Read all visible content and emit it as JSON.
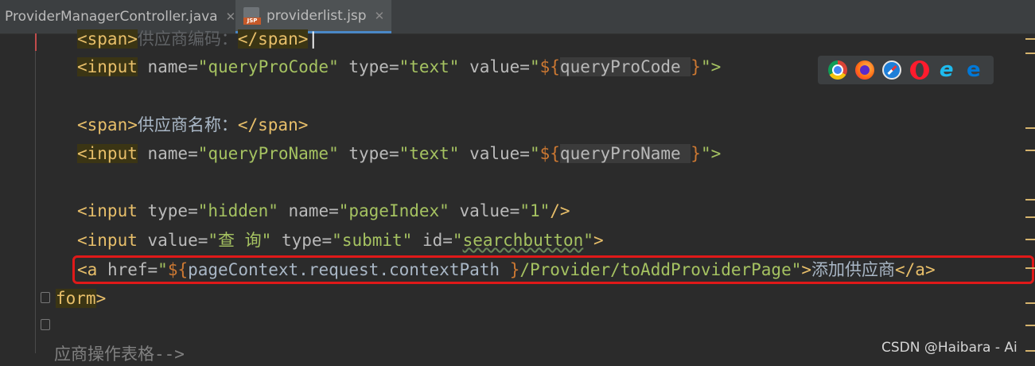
{
  "tabs": [
    {
      "label": "ProviderManagerController.java",
      "active": false
    },
    {
      "label": "providerlist.jsp",
      "active": true,
      "icon": "jsp-file-icon"
    }
  ],
  "code": {
    "line1": {
      "open": "<span>",
      "text": "供应商编码：",
      "close": "</span>"
    },
    "line2": {
      "tag": "<input",
      "attr1": " name=",
      "val1": "\"queryProCode\"",
      "attr2": " type=",
      "val2": "\"text\"",
      "attr3": " value=",
      "q": "\"",
      "el_open": "${",
      "el_body": "queryProCode ",
      "el_close": "}",
      "end": "\">"
    },
    "line4": {
      "open": "<span>",
      "text": "供应商名称：",
      "close": "</span>"
    },
    "line5": {
      "tag": "<input",
      "attr1": " name=",
      "val1": "\"queryProName\"",
      "attr2": " type=",
      "val2": "\"text\"",
      "attr3": " value=",
      "q": "\"",
      "el_open": "${",
      "el_body": "queryProName ",
      "el_close": "}",
      "end": "\">"
    },
    "line7": {
      "tag": "<input",
      "attr1": " type=",
      "val1": "\"hidden\"",
      "attr2": " name=",
      "val2": "\"pageIndex\"",
      "attr3": " value=",
      "val3": "\"1\"",
      "end": "/>"
    },
    "line8": {
      "tag": "<input",
      "attr1": " value=",
      "val1": "\"查 询\"",
      "attr2": " type=",
      "val2": "\"submit\"",
      "attr3": " id=",
      "q1": "\"",
      "idval": "searchbutton",
      "q2": "\"",
      "end": ">"
    },
    "line9": {
      "tag": "<a",
      "attr1": " href=",
      "q": "\"",
      "el_open": "${",
      "el_body": "pageContext.request.contextPath ",
      "el_close": "}",
      "path": "/Provider/toAddProviderPage\"",
      "gt": ">",
      "text": "添加供应商",
      "close": "</a>"
    },
    "line10": {
      "tag": "form",
      "gt": ">"
    },
    "line12": {
      "text": "应商操作表格-->"
    }
  },
  "browser_icons": [
    "chrome-icon",
    "firefox-icon",
    "safari-icon",
    "opera-icon",
    "ie-icon",
    "edge-icon"
  ],
  "watermark": "CSDN @Haibara - Ai",
  "colors": {
    "highlight_box": "#e01919",
    "tag": "#e8bf6a",
    "string": "#a5c261",
    "background": "#2b2b2b"
  }
}
